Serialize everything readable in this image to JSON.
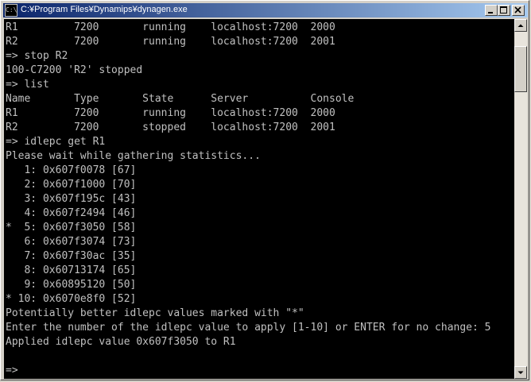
{
  "window": {
    "title": "C:¥Program Files¥Dynamips¥dynagen.exe",
    "icon_label": "C:\\",
    "controls": [
      "minimize-icon",
      "maximize-icon",
      "close-icon"
    ]
  },
  "console": {
    "lines": [
      "R1         7200       running    localhost:7200  2000",
      "R2         7200       running    localhost:7200  2001",
      "=> stop R2",
      "100-C7200 'R2' stopped",
      "=> list",
      "Name       Type       State      Server          Console",
      "R1         7200       running    localhost:7200  2000",
      "R2         7200       stopped    localhost:7200  2001",
      "=> idlepc get R1",
      "Please wait while gathering statistics...",
      "   1: 0x607f0078 [67]",
      "   2: 0x607f1000 [70]",
      "   3: 0x607f195c [43]",
      "   4: 0x607f2494 [46]",
      "*  5: 0x607f3050 [58]",
      "   6: 0x607f3074 [73]",
      "   7: 0x607f30ac [35]",
      "   8: 0x60713174 [65]",
      "   9: 0x60895120 [50]",
      "* 10: 0x6070e8f0 [52]",
      "Potentially better idlepc values marked with \"*\"",
      "Enter the number of the idlepc value to apply [1-10] or ENTER for no change: 5",
      "Applied idlepc value 0x607f3050 to R1",
      "",
      "=>"
    ]
  },
  "scrollbar": {
    "icons": [
      "scroll-up-arrow-icon",
      "scroll-down-arrow-icon"
    ]
  }
}
